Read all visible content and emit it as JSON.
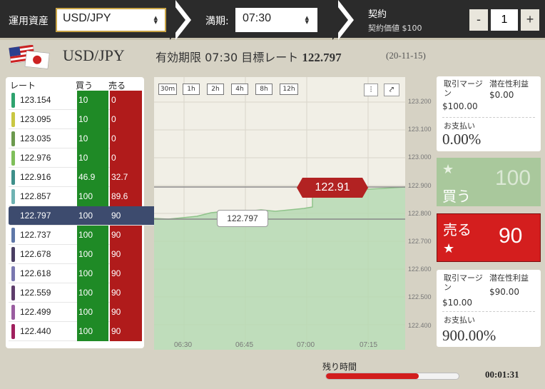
{
  "topbar": {
    "asset_label": "運用資産",
    "asset_value": "USD/JPY",
    "expiry_label": "満期:",
    "expiry_value": "07:30",
    "contract_label": "契約",
    "contract_value_label": "契約価値 $100",
    "qty_minus": "-",
    "qty_value": "1",
    "qty_plus": "+"
  },
  "header": {
    "pair": "USD/JPY",
    "expiry_text": "有効期限 07:30 目標レート",
    "target_rate": "122.797",
    "date": "(20-11-15)"
  },
  "rate_table": {
    "headers": [
      "レート",
      "買う",
      "売る"
    ],
    "rows": [
      {
        "rate": "123.154",
        "buy": "10",
        "sell": "0",
        "color": "#2ea36e"
      },
      {
        "rate": "123.095",
        "buy": "10",
        "sell": "0",
        "color": "#c9c742"
      },
      {
        "rate": "123.035",
        "buy": "10",
        "sell": "0",
        "color": "#6c9a4e"
      },
      {
        "rate": "122.976",
        "buy": "10",
        "sell": "0",
        "color": "#7fbf5a"
      },
      {
        "rate": "122.916",
        "buy": "46.9",
        "sell": "32.7",
        "color": "#3e8f8a"
      },
      {
        "rate": "122.857",
        "buy": "100",
        "sell": "89.6",
        "color": "#6fb3b3"
      },
      {
        "rate": "122.797",
        "buy": "100",
        "sell": "90",
        "color": "#3d4b6e"
      },
      {
        "rate": "122.737",
        "buy": "100",
        "sell": "90",
        "color": "#5f78a8"
      },
      {
        "rate": "122.678",
        "buy": "100",
        "sell": "90",
        "color": "#4a3f63"
      },
      {
        "rate": "122.618",
        "buy": "100",
        "sell": "90",
        "color": "#7a78b0"
      },
      {
        "rate": "122.559",
        "buy": "100",
        "sell": "90",
        "color": "#5e3d6b"
      },
      {
        "rate": "122.499",
        "buy": "100",
        "sell": "90",
        "color": "#9a5da0"
      },
      {
        "rate": "122.440",
        "buy": "100",
        "sell": "90",
        "color": "#a0205e"
      }
    ]
  },
  "chart": {
    "timeframes": [
      "30m",
      "1h",
      "2h",
      "4h",
      "8h",
      "12h"
    ],
    "y_ticks": [
      "123.200",
      "123.100",
      "123.000",
      "122.900",
      "122.800",
      "122.700",
      "122.600",
      "122.500",
      "122.400"
    ],
    "x_ticks": [
      "06:30",
      "06:45",
      "07:00",
      "07:15"
    ],
    "current_rate": "122.91",
    "target_rate": "122.797"
  },
  "buy_panel": {
    "margin_label": "取引マージン",
    "margin_value": "$100.00",
    "profit_label": "潜在性利益",
    "profit_value": "$0.00",
    "payout_label": "お支払い",
    "payout_value": "0.00%",
    "button_label": "買う",
    "button_value": "100"
  },
  "sell_panel": {
    "button_label": "売る",
    "button_value": "90",
    "margin_label": "取引マージン",
    "margin_value": "$10.00",
    "profit_label": "潜在性利益",
    "profit_value": "$90.00",
    "payout_label": "お支払い",
    "payout_value": "900.00%"
  },
  "footer": {
    "remaining_label": "残り時間",
    "remaining_fraction": 0.7,
    "timer": "00:01:31"
  }
}
